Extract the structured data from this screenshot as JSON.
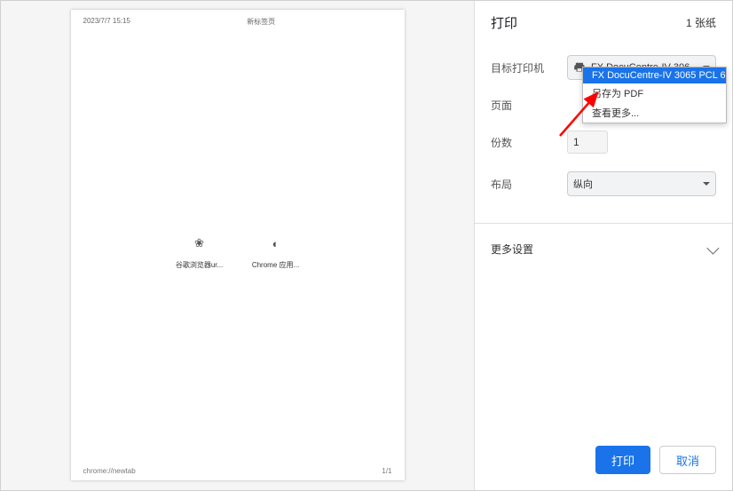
{
  "preview": {
    "timestamp": "2023/7/7 15:15",
    "title": "新标签页",
    "shortcuts": [
      {
        "icon": "❀",
        "label": "谷歌浏览器ur..."
      },
      {
        "icon": "◐",
        "label": "Chrome 应用..."
      }
    ],
    "footer_url": "chrome://newtab",
    "footer_page": "1/1"
  },
  "panel": {
    "heading": "打印",
    "sheet_count": "1 张纸",
    "labels": {
      "destination": "目标打印机",
      "pages": "页面",
      "copies": "份数",
      "layout": "布局",
      "more": "更多设置"
    },
    "destination_selected": "FX DocuCentre-IV 306",
    "dropdown_options": [
      "FX DocuCentre-IV 3065 PCL 6",
      "另存为 PDF",
      "查看更多..."
    ],
    "copies_value": "1",
    "layout_value": "纵向",
    "print_btn": "打印",
    "cancel_btn": "取消"
  }
}
